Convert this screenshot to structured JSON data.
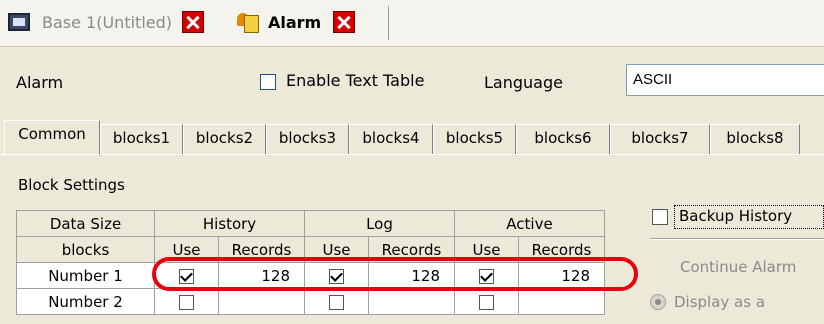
{
  "doc_tabs": [
    {
      "label": "Base 1(Untitled)",
      "icon": "screen-icon",
      "active": false
    },
    {
      "label": "Alarm",
      "icon": "alarm-icon",
      "active": true
    }
  ],
  "header": {
    "title": "Alarm",
    "enable_text_table_label": "Enable Text Table",
    "enable_text_table_checked": false,
    "language_label": "Language",
    "language_value": "ASCII"
  },
  "property_tabs": [
    "Common",
    "blocks1",
    "blocks2",
    "blocks3",
    "blocks4",
    "blocks5",
    "blocks6",
    "blocks7",
    "blocks8"
  ],
  "active_property_tab": "Common",
  "block_settings": {
    "title": "Block Settings",
    "header_row1": [
      "Data Size",
      "History",
      "Log",
      "Active"
    ],
    "header_row2": [
      "blocks",
      "Use",
      "Records",
      "Use",
      "Records",
      "Use",
      "Records"
    ],
    "rows": [
      {
        "label": "Number 1",
        "history_use": true,
        "history_records": "128",
        "log_use": true,
        "log_records": "128",
        "active_use": true,
        "active_records": "128"
      },
      {
        "label": "Number 2",
        "history_use": false,
        "history_records": "",
        "log_use": false,
        "log_records": "",
        "active_use": false,
        "active_records": ""
      }
    ]
  },
  "right_panel": {
    "backup_history_label": "Backup History",
    "backup_history_checked": false,
    "continue_alarm_label": "Continue Alarm",
    "display_as_label": "Display as a"
  },
  "colors": {
    "highlight": "#e8000f",
    "close_button": "#d40000",
    "dialog_background": "#ece9d8"
  }
}
